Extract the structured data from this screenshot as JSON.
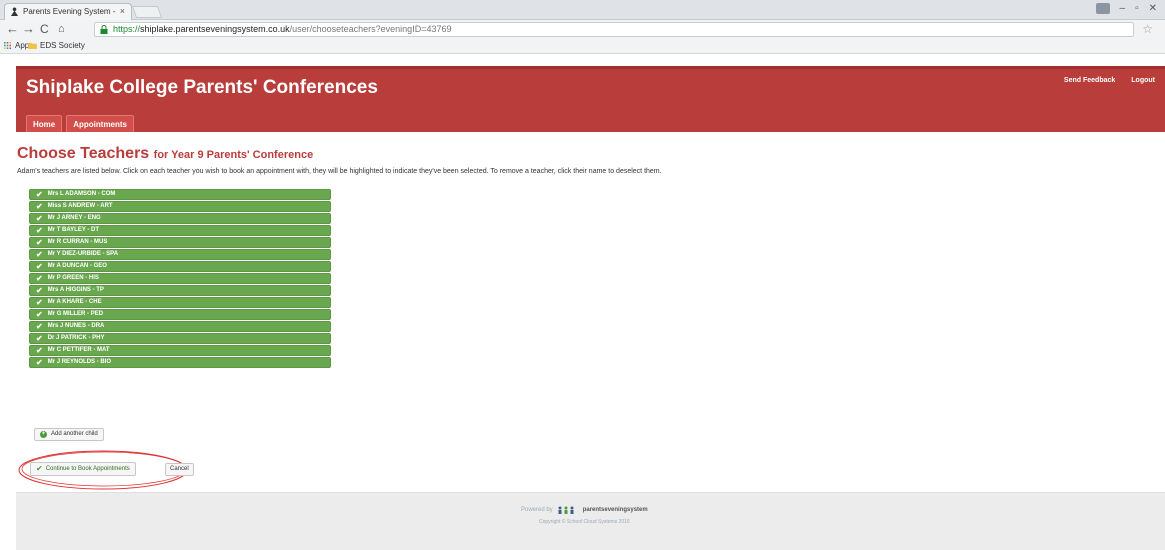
{
  "browser": {
    "tab_title": "Parents Evening System -",
    "tab_close": "×",
    "url_scheme": "https://",
    "url_host": "shiplake.parentseveningsystem.co.uk",
    "url_path": "/user/chooseteachers?eveningID=43769",
    "back_icon": "arrow-left-icon",
    "forward_icon": "arrow-right-icon",
    "reload_icon": "reload-icon",
    "home_icon": "home-icon",
    "bookmarks": [
      {
        "label": "Apps",
        "icon": "apps-grid-icon"
      },
      {
        "label": "EDS Society",
        "icon": "folder-icon"
      }
    ]
  },
  "header": {
    "title": "Shiplake College Parents' Conferences",
    "links": {
      "feedback": "Send Feedback",
      "logout": "Logout"
    },
    "nav": {
      "home": "Home",
      "appointments": "Appointments"
    }
  },
  "main": {
    "heading": "Choose Teachers",
    "subheading": "for Year 9 Parents' Conference",
    "intro": "Adam's teachers are listed below. Click on each teacher you wish to book an appointment with, they will be highlighted to indicate they've been selected. To remove a teacher, click their name to deselect them.",
    "teachers": [
      "Mrs L ADAMSON - COM",
      "Miss S ANDREW - ART",
      "Mr J ARNEY - ENG",
      "Mr T BAYLEY - DT",
      "Mr R CURRAN - MUS",
      "Mr Y DIEZ-URBIDE - SPA",
      "Mr A DUNCAN - GEO",
      "Mr P GREEN - HIS",
      "Mrs A HIGGINS - TP",
      "Mr A KHARE - CHE",
      "Mr G MILLER - PED",
      "Mrs J NUNES - DRA",
      "Dr J PATRICK - PHY",
      "Mr C PETTIFER - MAT",
      "Mr J REYNOLDS - BIO"
    ],
    "add_child": "Add another child",
    "continue": "Continue to Book Appointments",
    "cancel": "Cancel"
  },
  "footer": {
    "powered_by": "Powered by",
    "brand": "parentseveningsystem",
    "copyright": "Copyright © School Cloud Systems 2016"
  },
  "colors": {
    "header_red": "#b93d3b",
    "teacher_green": "#6aa84f",
    "highlight_ring": "#e03030"
  }
}
